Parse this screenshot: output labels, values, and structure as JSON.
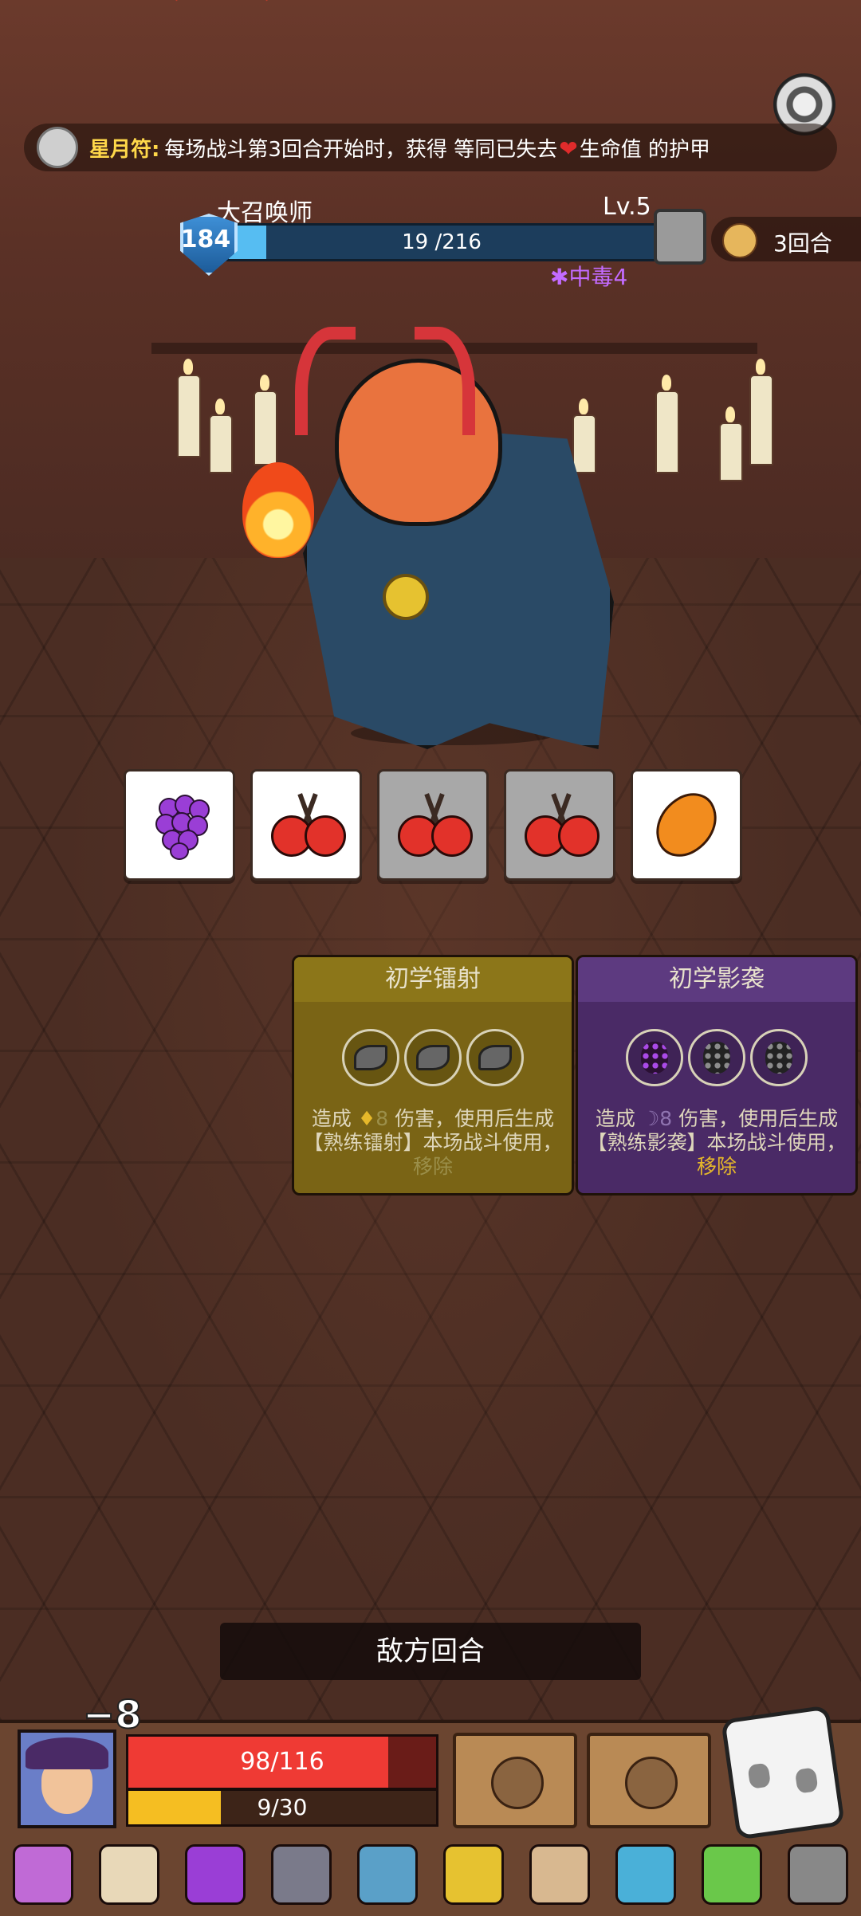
{
  "colors": {
    "accent_gold": "#ffd84a",
    "enemy_hp": "#56bdf2",
    "player_hp": "#ef3a34",
    "player_energy": "#f5be22",
    "poison": "#c36bff",
    "card_yellow": "#7a6415",
    "card_purple": "#4a2a66"
  },
  "banner": {
    "icon": "rune-disc-icon",
    "title": "星月符:",
    "text_before": "每场战斗第3回合开始时，获得 等同已失去",
    "text_after": "生命值 的护甲"
  },
  "enemy": {
    "name": "大召唤师",
    "level": "Lv.5",
    "shield": "184",
    "hp_text": "19 /216",
    "hp_current": 19,
    "hp_max": 216,
    "status": "中毒4"
  },
  "turn_counter": "3回合",
  "dice": [
    {
      "symbol": "grape",
      "state": "active"
    },
    {
      "symbol": "cherry",
      "state": "active"
    },
    {
      "symbol": "cherry",
      "state": "used"
    },
    {
      "symbol": "cherry",
      "state": "used"
    },
    {
      "symbol": "carrot",
      "state": "active"
    }
  ],
  "cards": [
    {
      "title": "初学镭射",
      "cost_icon": "♦",
      "damage": "8",
      "desc_pre": "造成",
      "desc_mid": "伤害，使用后生成【熟练镭射】本场战斗使用，",
      "desc_end": "移除"
    },
    {
      "title": "初学影袭",
      "cost_icon": "☽",
      "damage": "8",
      "desc_pre": "造成",
      "desc_mid": "伤害，使用后生成【熟练影袭】本场战斗使用，",
      "desc_end": "移除"
    }
  ],
  "enemy_turn_label": "敌方回合",
  "player": {
    "damage_float": "−8",
    "hp_text": "98/116",
    "hp_current": 98,
    "hp_max": 116,
    "energy_text": "9/30",
    "energy_current": 9,
    "energy_max": 30
  },
  "items": [
    {
      "name": "boot-icon",
      "color": "#c06ad6"
    },
    {
      "name": "scroll-icon",
      "color": "#e8d8b8"
    },
    {
      "name": "potion-icon",
      "color": "#9a3ed6"
    },
    {
      "name": "gem-icon",
      "color": "#7a7a8a"
    },
    {
      "name": "pickaxe-icon",
      "color": "#5aa0c8"
    },
    {
      "name": "crown-icon",
      "color": "#e6c230"
    },
    {
      "name": "horn-icon",
      "color": "#d8b890"
    },
    {
      "name": "pumpkin-icon",
      "color": "#4ab0d8"
    },
    {
      "name": "leaf-icon",
      "color": "#6ac84a"
    },
    {
      "name": "ghost-icon",
      "color": "#888888"
    }
  ]
}
